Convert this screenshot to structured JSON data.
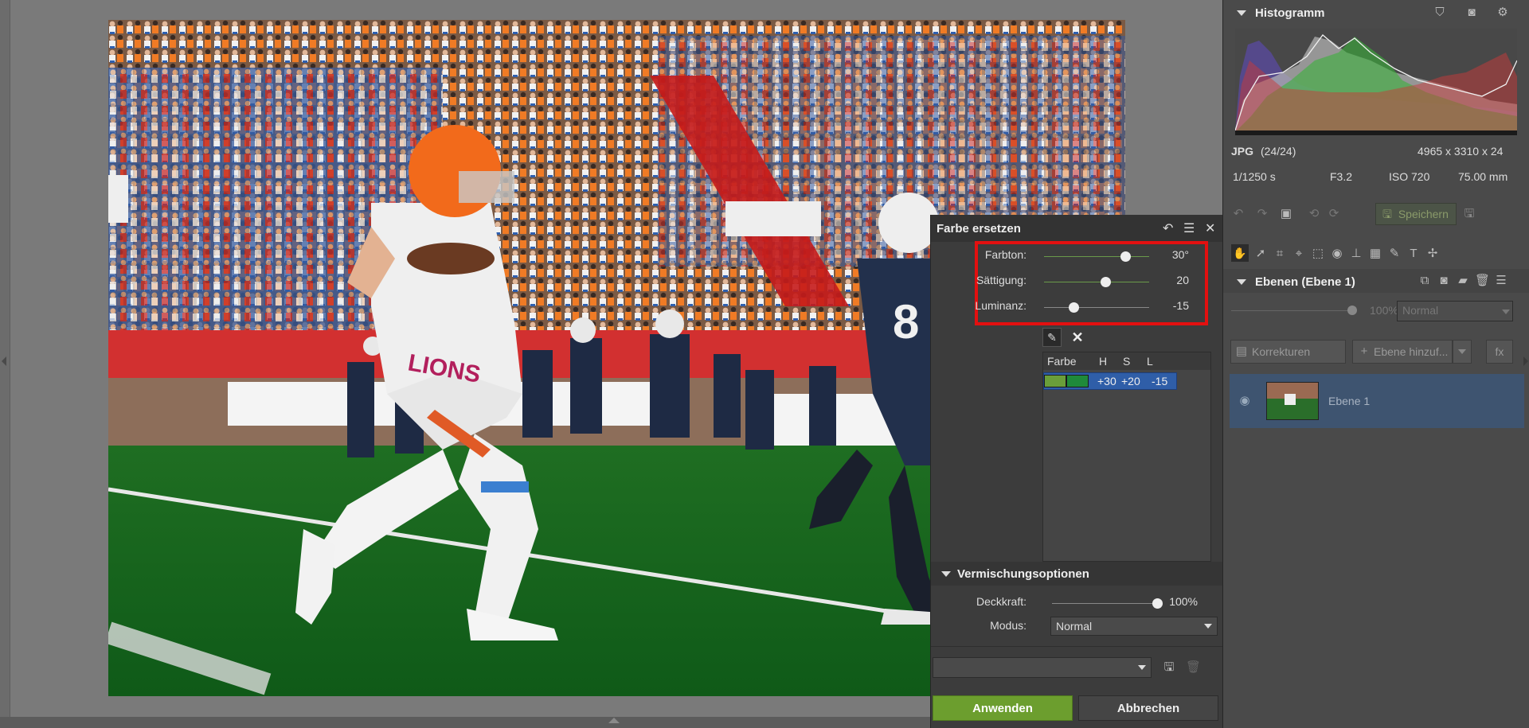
{
  "dialog": {
    "title": "Farbe ersetzen",
    "sliders": [
      {
        "label": "Farbton:",
        "value": "30°",
        "fraction": 0.77
      },
      {
        "label": "Sättigung:",
        "value": "20",
        "fraction": 0.58
      },
      {
        "label": "Luminanz:",
        "value": "-15",
        "fraction": 0.28
      }
    ],
    "table": {
      "headers": [
        "Farbe",
        "H",
        "S",
        "L"
      ],
      "rows": [
        {
          "h": "+30",
          "s": "+20",
          "l": "-15",
          "color_from": "#6a9e3a",
          "color_to": "#1f8a3a"
        }
      ]
    },
    "blend": {
      "title": "Vermischungsoptionen",
      "opacity_label": "Deckkraft:",
      "opacity_value": "100%",
      "opacity_fraction": 1.0,
      "mode_label": "Modus:",
      "mode_value": "Normal"
    },
    "apply_label": "Anwenden",
    "cancel_label": "Abbrechen"
  },
  "right_panel": {
    "histogram_title": "Histogramm",
    "file_format": "JPG",
    "file_index": "(24/24)",
    "dimensions": "4965 x 3310 x 24",
    "shutter": "1/1250 s",
    "aperture": "F3.2",
    "iso": "ISO 720",
    "focal": "75.00 mm",
    "save_label": "Speichern",
    "layers_title": "Ebenen (Ebene 1)",
    "layer_opacity": "100%",
    "layer_blend_mode": "Normal",
    "corrections_label": "Korrekturen",
    "add_layer_label": "Ebene hinzuf...",
    "fx_label": "fx",
    "layer_name": "Ebene 1"
  },
  "colors": {
    "accent_green": "#6c9e2e",
    "highlight_red": "#e31010",
    "selection_blue": "#2f5ea8"
  }
}
